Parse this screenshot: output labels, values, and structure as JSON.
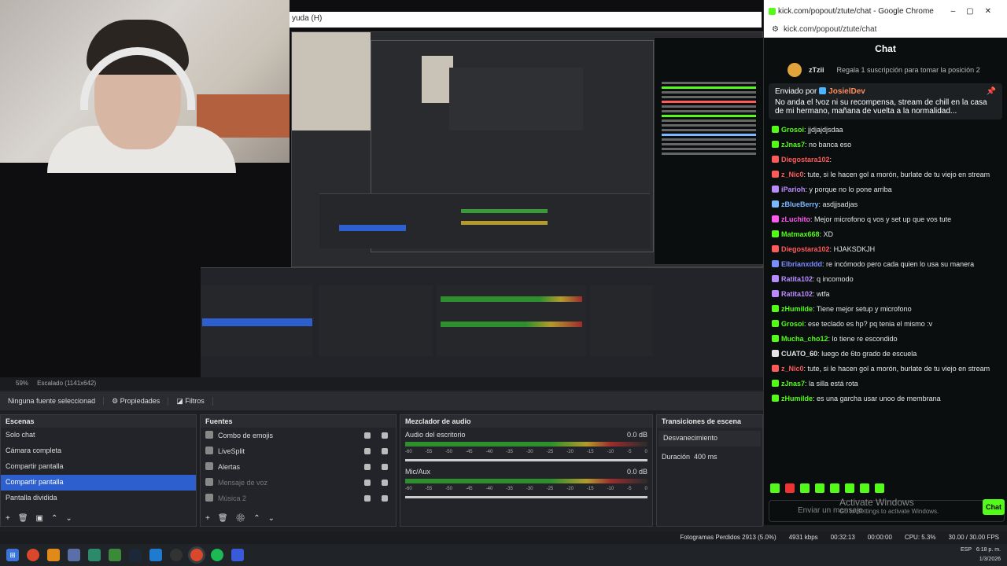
{
  "obs": {
    "menu_help": "yuda (H)",
    "scale_label": "59%",
    "scale_mode": "Escalado (1141x642)",
    "no_source": "Ninguna fuente seleccionad",
    "properties_tab": "Propiedades",
    "filters_tab": "Filtros",
    "scenes_title": "Escenas",
    "scenes": [
      "Solo chat",
      "Cámara completa",
      "Compartir pantalla",
      "Compartir pantalla",
      "Pantalla dividida"
    ],
    "sources_title": "Fuentes",
    "sources": [
      {
        "name": "Combo de emojis",
        "dim": false
      },
      {
        "name": "LiveSplit",
        "dim": false
      },
      {
        "name": "Alertas",
        "dim": false
      },
      {
        "name": "Mensaje de voz",
        "dim": true
      },
      {
        "name": "Música 2",
        "dim": true
      }
    ],
    "mixer_title": "Mezclador de audio",
    "mixer": [
      {
        "name": "Audio del escritorio",
        "db": "0.0 dB"
      },
      {
        "name": "Mic/Aux",
        "db": "0.0 dB"
      }
    ],
    "meter_ticks": [
      "-60",
      "-55",
      "-50",
      "-45",
      "-40",
      "-35",
      "-30",
      "-25",
      "-20",
      "-15",
      "-10",
      "-5",
      "0"
    ],
    "transitions_title": "Transiciones de escena",
    "transition_value": "Desvanecimiento",
    "duration_label": "Duración",
    "duration_value": "400 ms"
  },
  "status": {
    "dropped": "Fotogramas Perdidos 2913 (5.0%)",
    "kbps": "4931 kbps",
    "live_time": "00:32:13",
    "rec_time": "00:00:00",
    "cpu": "CPU: 5.3%",
    "fps": "30.00 / 30.00 FPS"
  },
  "kick": {
    "window_title": "kick.com/popout/ztute/chat - Google Chrome",
    "url": "kick.com/popout/ztute/chat",
    "chat_title": "Chat",
    "gift_user": "zTzii",
    "gift_text": "Regala 1 suscripción para tomar la posición 2",
    "pinned_by": "Enviado por",
    "pinned_user": "JosielDev",
    "pinned_text": "No anda el !voz ni su recompensa, stream de chill en la casa de mi hermano, mañana de vuelta a la normalidad...",
    "messages": [
      {
        "user": "Grosoi",
        "text": "jjdjajdjsdaa",
        "color": "#53fc18"
      },
      {
        "user": "zJnas7",
        "text": "no banca eso",
        "color": "#53fc18"
      },
      {
        "user": "Diegostara102",
        "text": "",
        "color": "#ff5a5a"
      },
      {
        "user": "z_Nic0",
        "text": "tute, si le hacen gol a morón, burlate de tu viejo en stream",
        "color": "#ff5a5a"
      },
      {
        "user": "iParioh",
        "text": "y porque no lo pone arriba",
        "color": "#b98bff"
      },
      {
        "user": "zBlueBerry",
        "text": "asdjjsadjas",
        "color": "#7ab8ff"
      },
      {
        "user": "zLuchito",
        "text": "Mejor microfono q vos y set up que vos tute",
        "color": "#ff5af0"
      },
      {
        "user": "Matmax668",
        "text": "XD",
        "color": "#53fc18"
      },
      {
        "user": "Diegostara102",
        "text": "HJAKSDKJH",
        "color": "#ff5a5a"
      },
      {
        "user": "Elbrianxddd",
        "text": "re incómodo pero cada quien lo usa su manera",
        "color": "#7a8cff"
      },
      {
        "user": "Ratita102",
        "text": "q incomodo",
        "color": "#b98bff"
      },
      {
        "user": "Ratita102",
        "text": "wtfa",
        "color": "#b98bff"
      },
      {
        "user": "zHumilde",
        "text": "Tiene mejor setup y microfono",
        "color": "#53fc18"
      },
      {
        "user": "Grosoi",
        "text": "ese teclado es hp? pq tenia el mismo :v",
        "color": "#53fc18"
      },
      {
        "user": "Mucha_cho12",
        "text": "lo tiene re escondido",
        "color": "#53fc18"
      },
      {
        "user": "CUATO_60",
        "text": "luego de 6to grado de escuela",
        "color": "#e5e5e5"
      },
      {
        "user": "z_Nic0",
        "text": "tute, si le hacen gol a morón, burlate de tu viejo en stream",
        "color": "#ff5a5a"
      },
      {
        "user": "zJnas7",
        "text": "la silla está rota",
        "color": "#53fc18"
      },
      {
        "user": "zHumilde",
        "text": "es una garcha usar unoo de membrana",
        "color": "#53fc18"
      }
    ],
    "input_placeholder": "Enviar un mensaje",
    "send_label": "Chat",
    "activate_windows": "Activate Windows",
    "activate_sub": "Go to Settings to activate Windows."
  },
  "taskbar": {
    "lang": "ESP",
    "time": "6:18 p. m.",
    "date": "1/3/2026"
  },
  "colors": {
    "accent_select": "#2e5fcf",
    "kick_green": "#53fc18"
  }
}
